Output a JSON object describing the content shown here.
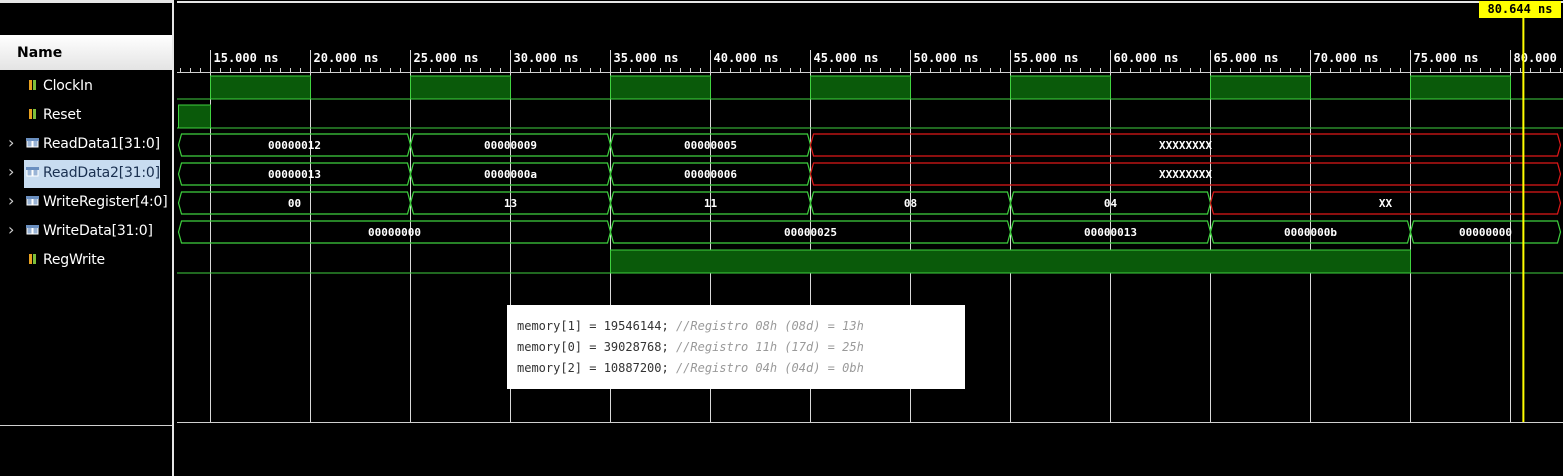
{
  "panel": {
    "header": "Name"
  },
  "signals": [
    {
      "name": "ClockIn",
      "type": "bit",
      "expand": false,
      "selected": false
    },
    {
      "name": "Reset",
      "type": "bit",
      "expand": false,
      "selected": false
    },
    {
      "name": "ReadData1[31:0]",
      "type": "bus",
      "expand": true,
      "selected": false
    },
    {
      "name": "ReadData2[31:0]",
      "type": "bus",
      "expand": true,
      "selected": true
    },
    {
      "name": "WriteRegister[4:0]",
      "type": "bus",
      "expand": true,
      "selected": false
    },
    {
      "name": "WriteData[31:0]",
      "type": "bus",
      "expand": true,
      "selected": false
    },
    {
      "name": "RegWrite",
      "type": "bit",
      "expand": false,
      "selected": false
    }
  ],
  "timeline": {
    "ticks": [
      "15.000 ns",
      "20.000 ns",
      "25.000 ns",
      "30.000 ns",
      "35.000 ns",
      "40.000 ns",
      "45.000 ns",
      "50.000 ns",
      "55.000 ns",
      "60.000 ns",
      "65.000 ns",
      "70.000 ns",
      "75.000 ns",
      "80.000 ns"
    ],
    "cursor": "80.644 ns"
  },
  "waves": {
    "ClockIn": {
      "high": [
        [
          15,
          20
        ],
        [
          25,
          30
        ],
        [
          35,
          40
        ],
        [
          45,
          50
        ],
        [
          55,
          60
        ],
        [
          65,
          70
        ],
        [
          75,
          80
        ]
      ]
    },
    "Reset": {
      "high": [
        [
          13.4,
          15
        ]
      ]
    },
    "ReadData1": [
      {
        "start": 13.4,
        "end": 25,
        "label": "00000012",
        "state": "valid"
      },
      {
        "start": 25,
        "end": 35,
        "label": "00000009",
        "state": "valid"
      },
      {
        "start": 35,
        "end": 45,
        "label": "00000005",
        "state": "valid"
      },
      {
        "start": 45,
        "end": 82.5,
        "label": "XXXXXXXX",
        "state": "unknown"
      }
    ],
    "ReadData2": [
      {
        "start": 13.4,
        "end": 25,
        "label": "00000013",
        "state": "valid"
      },
      {
        "start": 25,
        "end": 35,
        "label": "0000000a",
        "state": "valid"
      },
      {
        "start": 35,
        "end": 45,
        "label": "00000006",
        "state": "valid"
      },
      {
        "start": 45,
        "end": 82.5,
        "label": "XXXXXXXX",
        "state": "unknown"
      }
    ],
    "WriteRegister": [
      {
        "start": 13.4,
        "end": 25,
        "label": "00",
        "state": "valid"
      },
      {
        "start": 25,
        "end": 35,
        "label": "13",
        "state": "valid"
      },
      {
        "start": 35,
        "end": 45,
        "label": "11",
        "state": "valid"
      },
      {
        "start": 45,
        "end": 55,
        "label": "08",
        "state": "valid"
      },
      {
        "start": 55,
        "end": 65,
        "label": "04",
        "state": "valid"
      },
      {
        "start": 65,
        "end": 82.5,
        "label": "XX",
        "state": "unknown"
      }
    ],
    "WriteData": [
      {
        "start": 13.4,
        "end": 35,
        "label": "00000000",
        "state": "valid"
      },
      {
        "start": 35,
        "end": 55,
        "label": "00000025",
        "state": "valid"
      },
      {
        "start": 55,
        "end": 65,
        "label": "00000013",
        "state": "valid"
      },
      {
        "start": 65,
        "end": 75,
        "label": "0000000b",
        "state": "valid"
      },
      {
        "start": 75,
        "end": 82.5,
        "label": "00000000",
        "state": "valid"
      }
    ],
    "RegWrite": {
      "high": [
        [
          35,
          75
        ]
      ]
    }
  },
  "note": {
    "lines": [
      {
        "code": "memory[1] = 19546144; ",
        "comment": "//Registro 08h (08d) = 13h"
      },
      {
        "code": "memory[0] = 39028768; ",
        "comment": "//Registro 11h (17d) = 25h"
      },
      {
        "code": "memory[2] = 10887200; ",
        "comment": "//Registro 04h (04d) = 0bh"
      }
    ]
  },
  "colors": {
    "wave": "#3fd13f",
    "fill": "#0a5a0a",
    "unknown": "#e01818",
    "cursor": "#ffff00",
    "grid": "#d8d8d8"
  }
}
